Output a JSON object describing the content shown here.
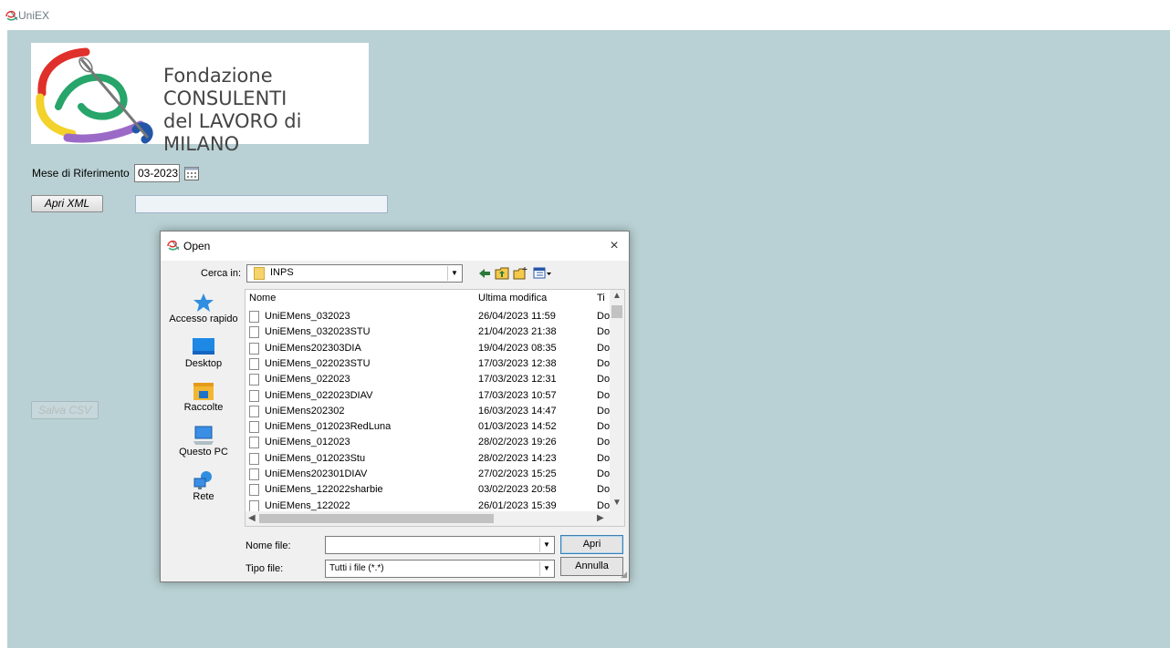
{
  "app": {
    "title": "UniEX"
  },
  "logo": {
    "line1": "Fondazione",
    "line2": "CONSULENTI",
    "line3": "del LAVORO di MILANO"
  },
  "form": {
    "mese_label": "Mese di Riferimento",
    "mese_value": "03-2023",
    "apri_xml_label": "Apri XML",
    "xml_path": "",
    "salva_csv_label": "Salva CSV"
  },
  "dialog": {
    "title": "Open",
    "close_glyph": "×",
    "lookin_label": "Cerca in:",
    "lookin_value": "INPS",
    "places": [
      {
        "label": "Accesso rapido",
        "icon": "star-icon"
      },
      {
        "label": "Desktop",
        "icon": "desktop-icon"
      },
      {
        "label": "Raccolte",
        "icon": "libraries-icon"
      },
      {
        "label": "Questo PC",
        "icon": "computer-icon"
      },
      {
        "label": "Rete",
        "icon": "network-icon"
      }
    ],
    "columns": {
      "name": "Nome",
      "modified": "Ultima modifica",
      "type": "Ti"
    },
    "files": [
      {
        "name": "UniEMens_032023",
        "date": "26/04/2023 11:59",
        "type": "Do"
      },
      {
        "name": "UniEMens_032023STU",
        "date": "21/04/2023 21:38",
        "type": "Do"
      },
      {
        "name": "UniEMens202303DIA",
        "date": "19/04/2023 08:35",
        "type": "Do"
      },
      {
        "name": "UniEMens_022023STU",
        "date": "17/03/2023 12:38",
        "type": "Do"
      },
      {
        "name": "UniEMens_022023",
        "date": "17/03/2023 12:31",
        "type": "Do"
      },
      {
        "name": "UniEMens_022023DIAV",
        "date": "17/03/2023 10:57",
        "type": "Do"
      },
      {
        "name": "UniEMens202302",
        "date": "16/03/2023 14:47",
        "type": "Do"
      },
      {
        "name": "UniEMens_012023RedLuna",
        "date": "01/03/2023 14:52",
        "type": "Do"
      },
      {
        "name": "UniEMens_012023",
        "date": "28/02/2023 19:26",
        "type": "Do"
      },
      {
        "name": "UniEMens_012023Stu",
        "date": "28/02/2023 14:23",
        "type": "Do"
      },
      {
        "name": "UniEMens202301DIAV",
        "date": "27/02/2023 15:25",
        "type": "Do"
      },
      {
        "name": "UniEMens_122022sharbie",
        "date": "03/02/2023 20:58",
        "type": "Do"
      },
      {
        "name": "UniEMens_122022",
        "date": "26/01/2023 15:39",
        "type": "Do"
      }
    ],
    "filename_label": "Nome file:",
    "filename_value": "",
    "filetype_label": "Tipo file:",
    "filetype_value": "Tutti i file (*.*)",
    "open_button": "Apri",
    "cancel_button": "Annulla"
  },
  "colors": {
    "client_bg": "#b9d1d4",
    "dialog_bg": "#f0f0f0"
  }
}
